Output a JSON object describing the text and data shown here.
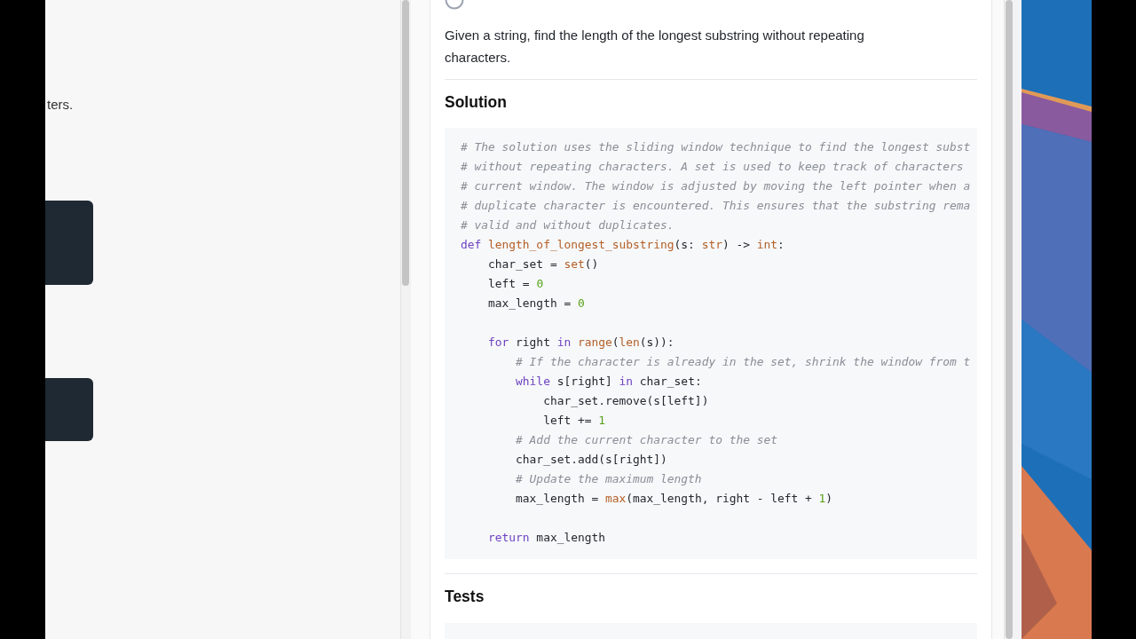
{
  "left_panel": {
    "text_fragment": "ters."
  },
  "question": {
    "text": "Given a string, find the length of the longest substring without repeating characters."
  },
  "solution": {
    "heading": "Solution",
    "code": [
      {
        "kind": "code",
        "tokens": [
          {
            "t": "# The solution uses the sliding window technique to find the longest subst",
            "kind": "comment"
          }
        ]
      },
      {
        "kind": "code",
        "tokens": [
          {
            "t": "# without repeating characters. A set is used to keep track of characters",
            "kind": "comment"
          }
        ]
      },
      {
        "kind": "code",
        "tokens": [
          {
            "t": "# current window. The window is adjusted by moving the left pointer when a",
            "kind": "comment"
          }
        ]
      },
      {
        "kind": "code",
        "tokens": [
          {
            "t": "# duplicate character is encountered. This ensures that the substring rema",
            "kind": "comment"
          }
        ]
      },
      {
        "kind": "code",
        "tokens": [
          {
            "t": "# valid and without duplicates.",
            "kind": "comment"
          }
        ]
      },
      {
        "kind": "code",
        "tokens": [
          {
            "t": "def ",
            "kind": "keyword"
          },
          {
            "t": "length_of_longest_substring",
            "kind": "function"
          },
          {
            "t": "(s: ",
            "kind": "plain"
          },
          {
            "t": "str",
            "kind": "builtin"
          },
          {
            "t": ") -> ",
            "kind": "plain"
          },
          {
            "t": "int",
            "kind": "builtin"
          },
          {
            "t": ":",
            "kind": "plain"
          }
        ]
      },
      {
        "kind": "code",
        "tokens": [
          {
            "t": "    char_set = ",
            "kind": "plain"
          },
          {
            "t": "set",
            "kind": "builtin"
          },
          {
            "t": "()",
            "kind": "plain"
          }
        ]
      },
      {
        "kind": "code",
        "tokens": [
          {
            "t": "    left = ",
            "kind": "plain"
          },
          {
            "t": "0",
            "kind": "number"
          }
        ]
      },
      {
        "kind": "code",
        "tokens": [
          {
            "t": "    max_length = ",
            "kind": "plain"
          },
          {
            "t": "0",
            "kind": "number"
          }
        ]
      },
      {
        "kind": "blank"
      },
      {
        "kind": "code",
        "tokens": [
          {
            "t": "    for",
            "kind": "keyword"
          },
          {
            "t": " right ",
            "kind": "plain"
          },
          {
            "t": "in ",
            "kind": "keyword"
          },
          {
            "t": "range",
            "kind": "builtin"
          },
          {
            "t": "(",
            "kind": "plain"
          },
          {
            "t": "len",
            "kind": "builtin"
          },
          {
            "t": "(s)):",
            "kind": "plain"
          }
        ]
      },
      {
        "kind": "code",
        "tokens": [
          {
            "t": "        # If the character is already in the set, shrink the window from t",
            "kind": "comment"
          }
        ]
      },
      {
        "kind": "code",
        "tokens": [
          {
            "t": "        while",
            "kind": "keyword"
          },
          {
            "t": " s[right] ",
            "kind": "plain"
          },
          {
            "t": "in",
            "kind": "keyword"
          },
          {
            "t": " char_set:",
            "kind": "plain"
          }
        ]
      },
      {
        "kind": "code",
        "tokens": [
          {
            "t": "            char_set.remove(s[left])",
            "kind": "plain"
          }
        ]
      },
      {
        "kind": "code",
        "tokens": [
          {
            "t": "            left += ",
            "kind": "plain"
          },
          {
            "t": "1",
            "kind": "number"
          }
        ]
      },
      {
        "kind": "code",
        "tokens": [
          {
            "t": "        # Add the current character to the set",
            "kind": "comment"
          }
        ]
      },
      {
        "kind": "code",
        "tokens": [
          {
            "t": "        char_set.add(s[right])",
            "kind": "plain"
          }
        ]
      },
      {
        "kind": "code",
        "tokens": [
          {
            "t": "        # Update the maximum length",
            "kind": "comment"
          }
        ]
      },
      {
        "kind": "code",
        "tokens": [
          {
            "t": "        max_length = ",
            "kind": "plain"
          },
          {
            "t": "max",
            "kind": "builtin"
          },
          {
            "t": "(max_length, right - left + ",
            "kind": "plain"
          },
          {
            "t": "1",
            "kind": "number"
          },
          {
            "t": ")",
            "kind": "plain"
          }
        ]
      },
      {
        "kind": "blank"
      },
      {
        "kind": "code",
        "tokens": [
          {
            "t": "    return",
            "kind": "keyword"
          },
          {
            "t": " max_length",
            "kind": "plain"
          }
        ]
      }
    ]
  },
  "tests": {
    "heading": "Tests"
  }
}
